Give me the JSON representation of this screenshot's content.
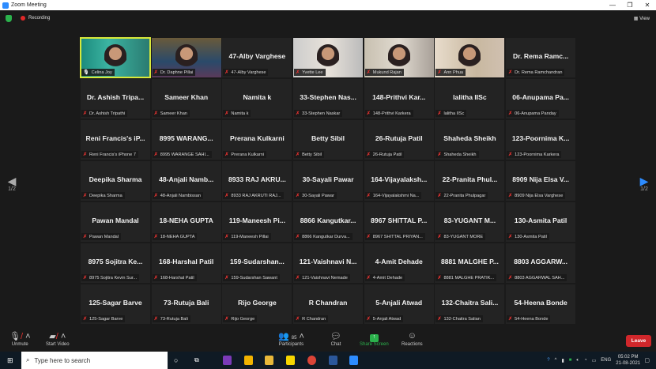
{
  "window": {
    "title": "Zoom Meeting"
  },
  "recording": {
    "label": "Recording",
    "view_label": "View"
  },
  "pager": {
    "prev": "1/2",
    "next": "1/2"
  },
  "tiles": [
    {
      "big": "",
      "label": "Celina Joy",
      "video": true,
      "active": true
    },
    {
      "big": "",
      "label": "Dr. Daphne Pillai",
      "video": true
    },
    {
      "big": "47-Alby Varghese",
      "label": "47-Alby Varghese"
    },
    {
      "big": "",
      "label": "Yvette Lee",
      "video": true
    },
    {
      "big": "",
      "label": "Mukund Rajan",
      "video": true
    },
    {
      "big": "",
      "label": "Ann Phua",
      "video": true
    },
    {
      "big": "Dr. Rema Ramc...",
      "label": "Dr. Rema Ramchandran"
    },
    {
      "big": "Dr. Ashish Tripa...",
      "label": "Dr. Ashish Tripathi"
    },
    {
      "big": "Sameer Khan",
      "label": "Sameer Khan"
    },
    {
      "big": "Namita k",
      "label": "Namita k"
    },
    {
      "big": "33-Stephen Nas...",
      "label": "33-Stephen Naskar"
    },
    {
      "big": "148-Prithvi Kar...",
      "label": "148-Prithvi Karkera"
    },
    {
      "big": "lalitha IISc",
      "label": "lalitha IISc"
    },
    {
      "big": "06-Anupama Pa...",
      "label": "06-Anupama Panday"
    },
    {
      "big": "Reni Francis's iP...",
      "label": "Reni Francis's iPhone 7"
    },
    {
      "big": "8995 WARANG...",
      "label": "8995 WARANGE SAHI..."
    },
    {
      "big": "Prerana Kulkarni",
      "label": "Prerana Kulkarni"
    },
    {
      "big": "Betty Sibil",
      "label": "Betty Sibil"
    },
    {
      "big": "26-Rutuja Patil",
      "label": "26-Rutuja Patil"
    },
    {
      "big": "Shaheda Sheikh",
      "label": "Shaheda Sheikh"
    },
    {
      "big": "123-Poornima K...",
      "label": "123-Poornima Karkera"
    },
    {
      "big": "Deepika Sharma",
      "label": "Deepika Sharma"
    },
    {
      "big": "48-Anjali Namb...",
      "label": "48-Anjali Nambissan"
    },
    {
      "big": "8933 RAJ AKRU...",
      "label": "8933 RAJ AKRUTI RAJ..."
    },
    {
      "big": "30-Sayali Pawar",
      "label": "30-Sayali Pawar"
    },
    {
      "big": "164-Vijayalaksh...",
      "label": "164-Vijayalakshmi Na..."
    },
    {
      "big": "22-Pranita Phul...",
      "label": "22-Pranita Phulpagar"
    },
    {
      "big": "8909 Nija Elsa V...",
      "label": "8909 Nija Elsa Varghese"
    },
    {
      "big": "Pawan Mandal",
      "label": "Pawan Mandal"
    },
    {
      "big": "18-NEHA GUPTA",
      "label": "18-NEHA GUPTA"
    },
    {
      "big": "119-Maneesh Pi...",
      "label": "119-Maneesh Pillai"
    },
    {
      "big": "8866 Kangutkar...",
      "label": "8866 Kangutkar Durva..."
    },
    {
      "big": "8967 SHITTAL P...",
      "label": "8967 SHITTAL PRIYAN..."
    },
    {
      "big": "83-YUGANT M...",
      "label": "83-YUGANT MORE"
    },
    {
      "big": "130-Asmita Patil",
      "label": "130-Asmita Patil"
    },
    {
      "big": "8975 Sojitra Ke...",
      "label": "8975 Sojitra Kevin Sur..."
    },
    {
      "big": "168-Harshal Patil",
      "label": "168-Harshal Patil"
    },
    {
      "big": "159-Sudarshan...",
      "label": "159-Sudarshan Sawant"
    },
    {
      "big": "121-Vaishnavi N...",
      "label": "121-Vaishnavi Nemade"
    },
    {
      "big": "4-Amit Dehade",
      "label": "4-Amit Dehade"
    },
    {
      "big": "8881 MALGHE P...",
      "label": "8881 MALGHE PRATIK..."
    },
    {
      "big": "8803 AGGARW...",
      "label": "8803 AGGARWAL SAH..."
    },
    {
      "big": "125-Sagar Barve",
      "label": "125-Sagar Barve"
    },
    {
      "big": "73-Rutuja Bali",
      "label": "73-Rutuja Bali"
    },
    {
      "big": "Rijo George",
      "label": "Rijo George"
    },
    {
      "big": "R Chandran",
      "label": "R Chandran"
    },
    {
      "big": "5-Anjali Atwad",
      "label": "5-Anjali Atwad"
    },
    {
      "big": "132-Chaitra Sali...",
      "label": "132-Chaitra Salian"
    },
    {
      "big": "54-Heena Bonde",
      "label": "54-Heena Bonde"
    }
  ],
  "controls": {
    "unmute": "Unmute",
    "start_video": "Start Video",
    "participants": "Participants",
    "participants_count": "85",
    "chat": "Chat",
    "share_screen": "Share Screen",
    "reactions": "Reactions",
    "leave": "Leave"
  },
  "taskbar": {
    "search_placeholder": "Type here to search",
    "lang": "ENG",
    "time": "05:02 PM",
    "date": "21-08-2021"
  },
  "colors": {
    "leave": "#d1272b",
    "share": "#2bb24c",
    "active_speaker": "#d8e83a"
  }
}
